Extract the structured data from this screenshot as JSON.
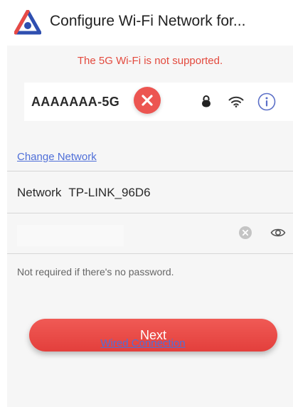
{
  "header": {
    "title": "Configure Wi-Fi Network for..."
  },
  "warning": {
    "text": "The 5G Wi-Fi is not supported."
  },
  "network_card": {
    "ssid": "AAAAAAA-5G",
    "status_icon": "close-icon",
    "lock_icon": "lock-icon",
    "signal_icon": "wifi-icon",
    "info_icon": "info-icon"
  },
  "links": {
    "change_network": "Change Network",
    "wired_connection": "Wired Connection"
  },
  "network": {
    "label": "Network",
    "value": "TP-LINK_96D6"
  },
  "password": {
    "value": "",
    "hint": "Not required if there's no password."
  },
  "buttons": {
    "next": "Next"
  },
  "colors": {
    "accent": "#e84a45",
    "link": "#4f6fd8",
    "warning": "#e34a3e"
  }
}
